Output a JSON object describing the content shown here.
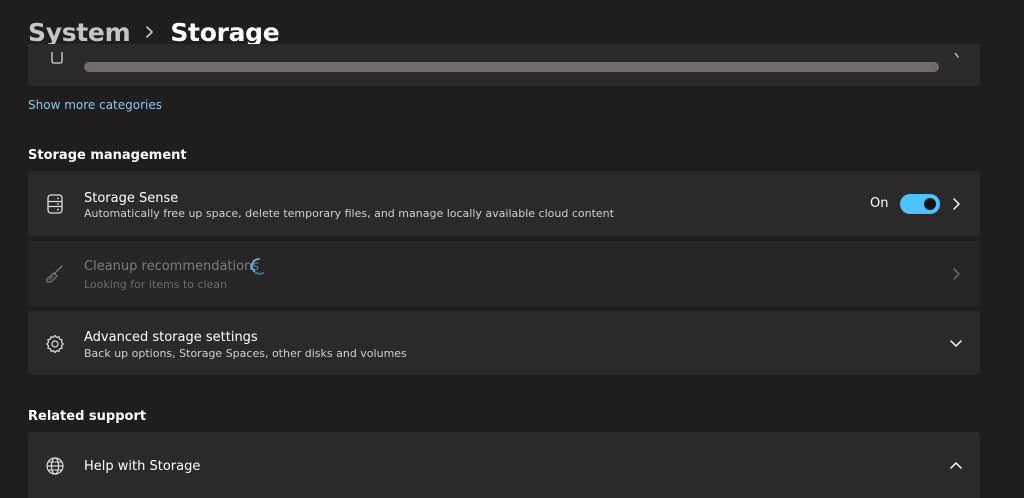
{
  "header": {
    "parent": "System",
    "current": "Storage"
  },
  "usage_row": {
    "icon": "trash-icon",
    "fill_fraction": 1.0
  },
  "links": {
    "show_more": "Show more categories"
  },
  "storage_management": {
    "title": "Storage management",
    "storage_sense": {
      "icon": "storage-drive-icon",
      "title": "Storage Sense",
      "subtitle": "Automatically free up space, delete temporary files, and manage locally available cloud content",
      "toggle_label": "On",
      "toggle_on": true
    },
    "cleanup": {
      "icon": "broom-icon",
      "title": "Cleanup recommendations",
      "subtitle": "Looking for items to clean",
      "loading": true
    },
    "advanced": {
      "icon": "gear-icon",
      "title": "Advanced storage settings",
      "subtitle": "Back up options, Storage Spaces, other disks and volumes"
    }
  },
  "related_support": {
    "title": "Related support",
    "help": {
      "icon": "globe-icon",
      "title": "Help with Storage"
    }
  },
  "colors": {
    "background": "#201d1d",
    "card": "#2b2929",
    "accent": "#4cc2ff",
    "link": "#8fc6ea"
  }
}
